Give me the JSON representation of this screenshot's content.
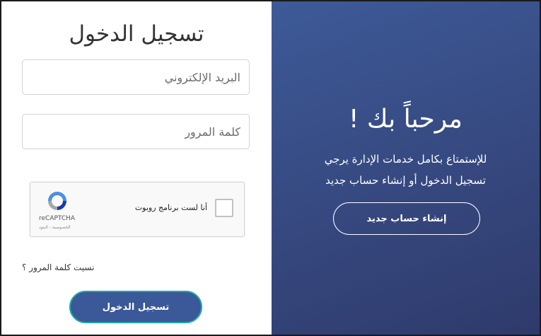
{
  "login": {
    "title": "تسجيل الدخول",
    "email_placeholder": "البريد الإلكتروني",
    "password_placeholder": "كلمة المرور",
    "forgot_link": "نسيت كلمة المرور ؟",
    "submit_label": "تسجيل الدخول"
  },
  "captcha": {
    "label": "أنا لست برنامج روبوت",
    "brand": "reCAPTCHA",
    "terms": "الخصوصية - البنود",
    "logo_icon": "recaptcha-logo-icon"
  },
  "welcome": {
    "heading": "مرحباً بك !",
    "line1": "للإستمتاع بكامل خدمات الإدارة يرجي",
    "line2": "تسجيل الدخول أو إنشاء حساب جديد",
    "signup_label": "إنشاء حساب جديد"
  },
  "colors": {
    "panel": "#3d5a98",
    "button_border": "#1ba8a8"
  }
}
